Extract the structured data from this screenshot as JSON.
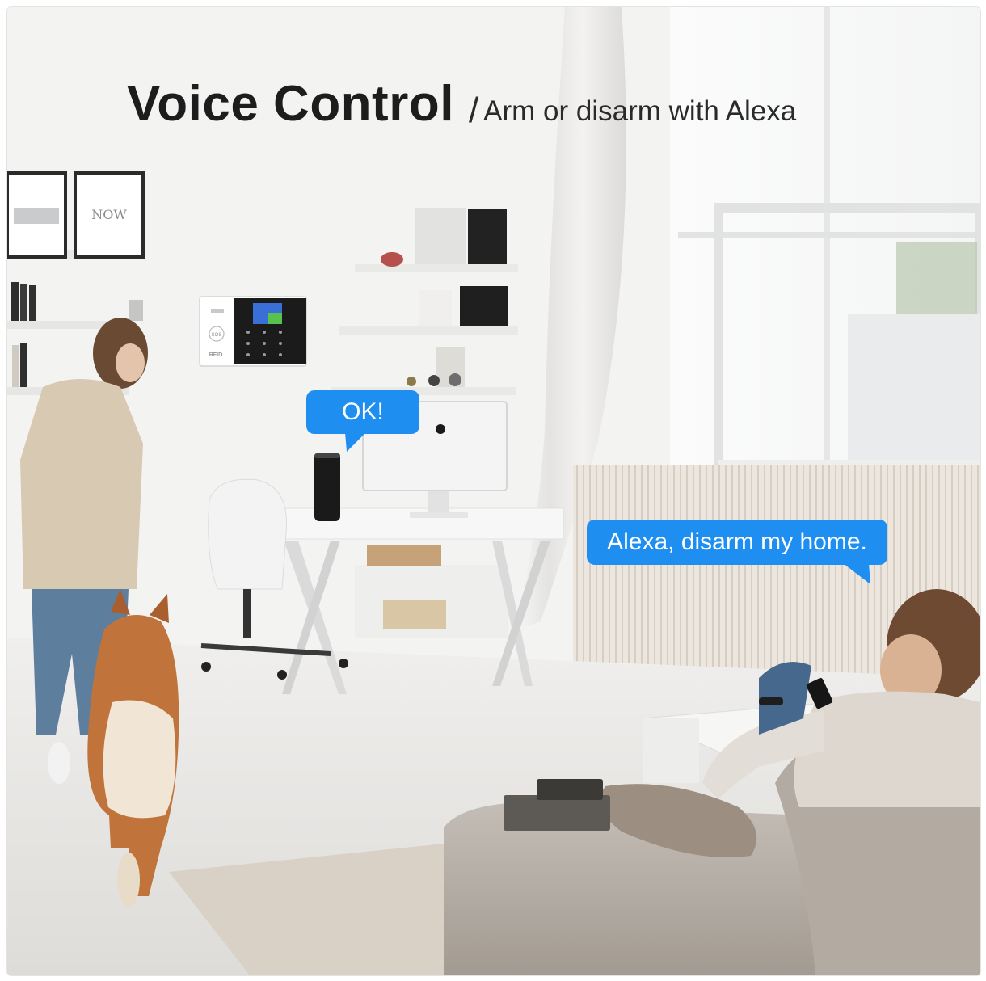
{
  "headline": {
    "title": "Voice Control",
    "separator": "/",
    "subtitle": "Arm or disarm with Alexa"
  },
  "speech": {
    "speaker_reply": "OK!",
    "user_command": "Alexa, disarm my home."
  },
  "wall_art": {
    "frame_text": "NOW"
  },
  "alarm_panel": {
    "sos_label": "SOS",
    "rfid_label": "RFID"
  },
  "colors": {
    "bubble": "#1e8ff0",
    "headline_text": "#1d1d1d",
    "wall": "#f3f3f2",
    "sofa": "#b9b2aa",
    "floor": "#ebeae8"
  }
}
